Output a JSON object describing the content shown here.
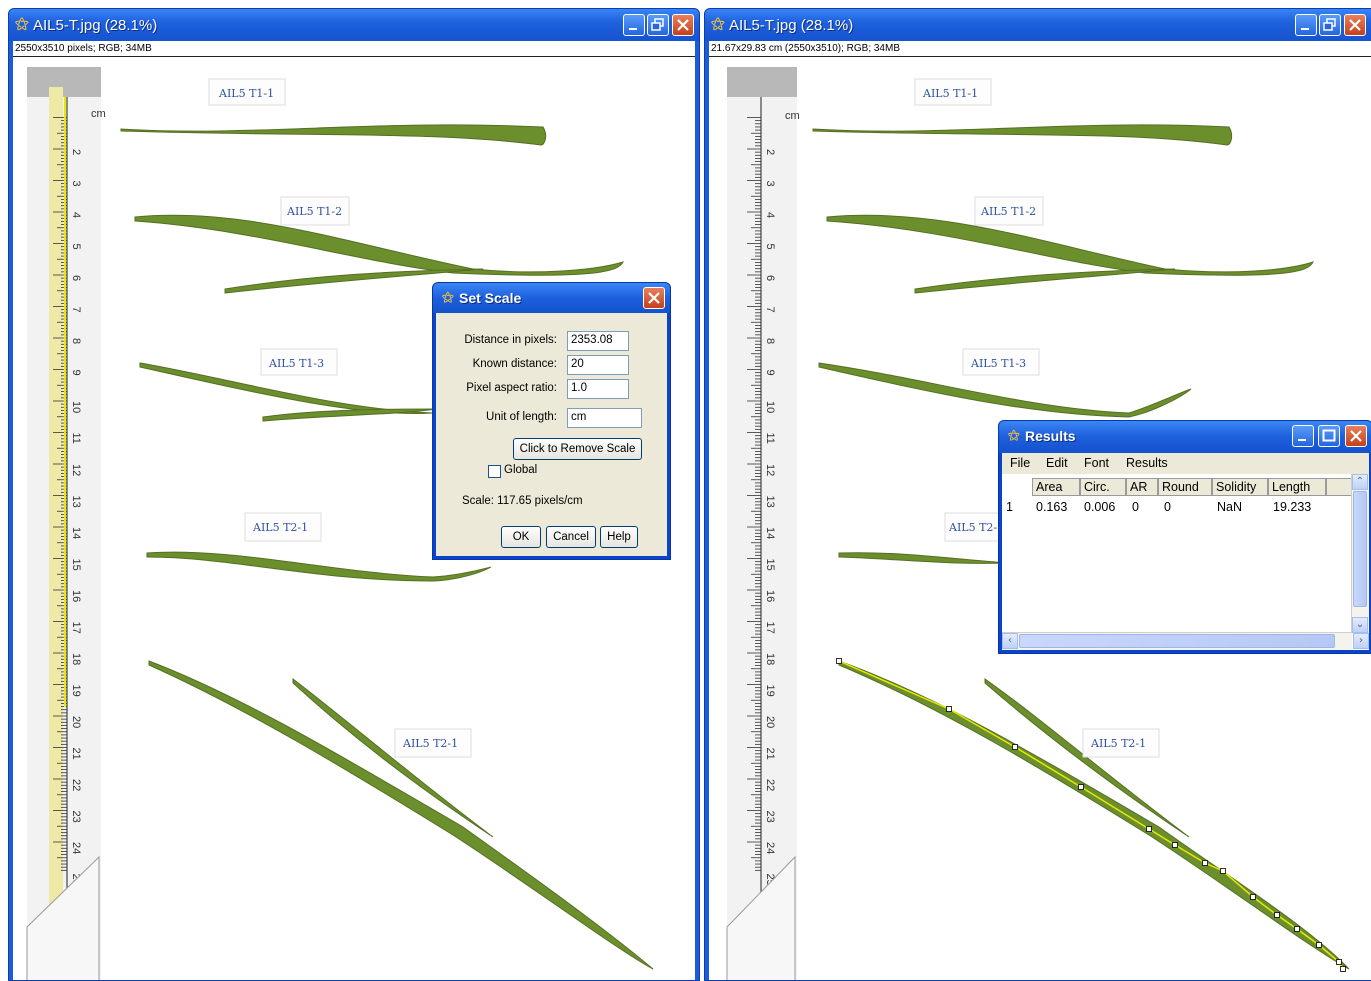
{
  "left_window": {
    "title": "AIL5-T.jpg (28.1%)",
    "info": "2550x3510 pixels; RGB; 34MB"
  },
  "right_window": {
    "title": "AIL5-T.jpg (28.1%)",
    "info": "21.67x29.83 cm (2550x3510); RGB; 34MB"
  },
  "ruler": {
    "unit": "cm",
    "numbers": [
      "2",
      "3",
      "4",
      "5",
      "6",
      "7",
      "8",
      "9",
      "10",
      "11",
      "12",
      "13",
      "14",
      "15",
      "16",
      "17",
      "18",
      "19",
      "20",
      "21",
      "22",
      "23",
      "24",
      "25"
    ]
  },
  "labels": {
    "tag1": "AIL5 T1-1",
    "tag2": "AIL5 T1-2",
    "tag3": "AIL5 T1-3",
    "tag4": "AIL5 T2-1",
    "tag5": "AIL5 T2-1"
  },
  "set_scale": {
    "title": "Set Scale",
    "distance_label": "Distance in pixels:",
    "distance_value": "2353.08",
    "known_label": "Known distance:",
    "known_value": "20",
    "aspect_label": "Pixel aspect ratio:",
    "aspect_value": "1.0",
    "unit_label": "Unit of length:",
    "unit_value": "cm",
    "remove_button": "Click to Remove Scale",
    "global_label": "Global",
    "global_checked": false,
    "scale_text": "Scale: 117.65 pixels/cm",
    "ok_button": "OK",
    "cancel_button": "Cancel",
    "help_button": "Help"
  },
  "results": {
    "title": "Results",
    "menu": [
      "File",
      "Edit",
      "Font",
      "Results"
    ],
    "columns": [
      "Area",
      "Circ.",
      "AR",
      "Round",
      "Solidity",
      "Length"
    ],
    "rows": [
      {
        "index": "1",
        "values": [
          "0.163",
          "0.006",
          "0",
          "0",
          "NaN",
          "19.233"
        ]
      }
    ]
  },
  "colors": {
    "titlebar": "#1d5cd6",
    "leaf": "#6c8f2e",
    "selection": "#e8e800"
  },
  "icons": [
    "imagej-icon",
    "minimize-icon",
    "restore-icon",
    "close-icon",
    "maximize-icon"
  ]
}
